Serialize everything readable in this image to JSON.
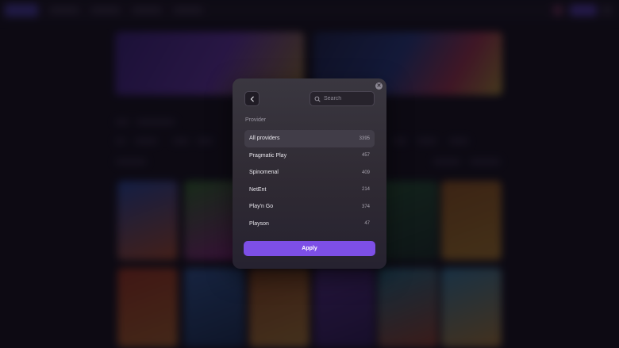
{
  "modal": {
    "search_placeholder": "Search",
    "section_label": "Provider",
    "providers": [
      {
        "name": "All providers",
        "count": "3395",
        "selected": true
      },
      {
        "name": "Pragmatic Play",
        "count": "457"
      },
      {
        "name": "Spinomenal",
        "count": "409"
      },
      {
        "name": "NetEnt",
        "count": "214"
      },
      {
        "name": "Play'n Go",
        "count": "374"
      },
      {
        "name": "Playson",
        "count": "47"
      }
    ],
    "apply_label": "Apply"
  },
  "icons": {
    "close": "close-icon",
    "back": "chevron-left-icon",
    "search": "search-icon"
  },
  "colors": {
    "accent": "#7d4fe6",
    "modal_bg": "#333038",
    "selected_row": "#413d48"
  }
}
